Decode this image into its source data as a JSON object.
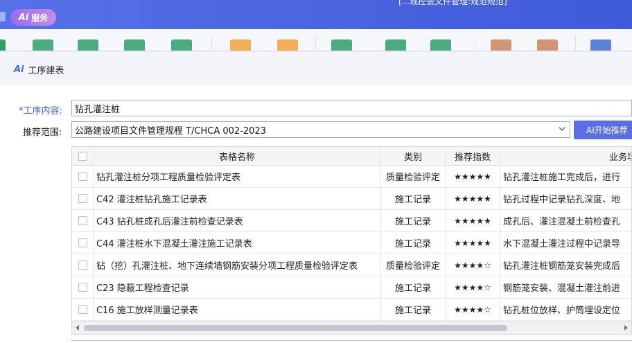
{
  "app": {
    "ai_badge_mark": "Ai",
    "ai_badge_label": "服务",
    "window_title_fragment": "[...观控会文件管理:规范规范]"
  },
  "ribbon": {
    "icons": [
      {
        "name": "table-icon",
        "color": "#2f9e6a"
      },
      {
        "name": "list-icon",
        "color": "#2f9e6a"
      },
      {
        "name": "number-table-icon",
        "color": "#2f9e6a"
      },
      {
        "name": "bar-chart-icon",
        "color": "#2f9e6a"
      },
      {
        "name": "search-icon",
        "color": "#f2a23a"
      },
      {
        "name": "undo-icon",
        "color": "#f2a23a"
      },
      {
        "name": "grid-icon",
        "color": "#2f9e6a"
      },
      {
        "name": "refresh-icon",
        "color": "#2f9e6a"
      },
      {
        "name": "print-icon",
        "color": "#2f9e6a"
      },
      {
        "name": "folder-icon",
        "color": "#c9855b"
      },
      {
        "name": "document-icon",
        "color": "#c9855b"
      },
      {
        "name": "save-icon",
        "color": "#3d6fd1"
      }
    ]
  },
  "dialog": {
    "title_logo": "Ai",
    "title": "工序建表",
    "process_label_req": "*",
    "process_label": "工序内容:",
    "process_value": "钻孔灌注桩",
    "scope_label": "推荐范围:",
    "scope_value": "公路建设项目文件管理规程 T/CHCA 002-2023",
    "ai_button_label": "AI开始推荐"
  },
  "table": {
    "headers": {
      "name": "表格名称",
      "category": "类别",
      "rating": "推荐指数",
      "business": "业务场"
    },
    "rows": [
      {
        "name": "钻孔灌注桩分项工程质量检验评定表",
        "category": "质量检验评定",
        "rating": "★★★★★",
        "business": "钻孔灌注桩施工完成后，进行"
      },
      {
        "name": "C42 灌注桩钻孔施工记录表",
        "category": "施工记录",
        "rating": "★★★★★",
        "business": "钻孔过程中记录钻孔深度、地"
      },
      {
        "name": "C43 钻孔桩成孔后灌注前检查记录表",
        "category": "施工记录",
        "rating": "★★★★★",
        "business": "成孔后、灌注混凝土前检查孔"
      },
      {
        "name": "C44 灌注桩水下混凝土灌注施工记录表",
        "category": "施工记录",
        "rating": "★★★★★",
        "business": "水下混凝土灌注过程中记录导"
      },
      {
        "name": "钻（挖）孔灌注桩、地下连续墙钢筋安装分项工程质量检验评定表",
        "category": "质量检验评定",
        "rating": "★★★★☆",
        "business": "钻孔灌注桩钢筋笼安装完成后"
      },
      {
        "name": "C23 隐蔽工程检查记录",
        "category": "施工记录",
        "rating": "★★★★☆",
        "business": "钢筋笼安装、混凝土灌注前进"
      },
      {
        "name": "C16 施工放样测量记录表",
        "category": "施工记录",
        "rating": "★★★★☆",
        "business": "钻孔桩位放样、护筒埋设定位"
      }
    ]
  },
  "scrollbar": {
    "position_fraction": 0.0,
    "visible_fraction": 0.79
  }
}
